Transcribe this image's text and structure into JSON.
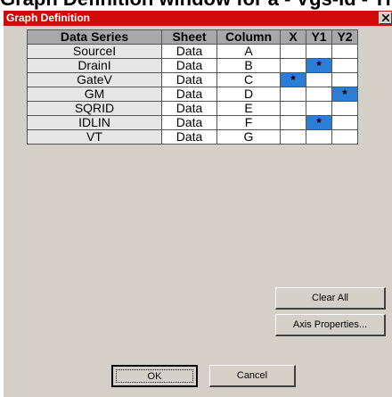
{
  "background_caption": "Graph Definition window for a - Vgs-Id - Th",
  "window": {
    "title": "Graph Definition"
  },
  "table": {
    "headers": [
      "Data Series",
      "Sheet",
      "Column",
      "X",
      "Y1",
      "Y2"
    ],
    "rows": [
      {
        "name": "SourceI",
        "sheet": "Data",
        "column": "A",
        "x": "",
        "y1": "",
        "y2": ""
      },
      {
        "name": "DrainI",
        "sheet": "Data",
        "column": "B",
        "x": "",
        "y1": "*",
        "y2": ""
      },
      {
        "name": "GateV",
        "sheet": "Data",
        "column": "C",
        "x": "*",
        "y1": "",
        "y2": ""
      },
      {
        "name": "GM",
        "sheet": "Data",
        "column": "D",
        "x": "",
        "y1": "",
        "y2": "*"
      },
      {
        "name": "SQRID",
        "sheet": "Data",
        "column": "E",
        "x": "",
        "y1": "",
        "y2": ""
      },
      {
        "name": "IDLIN",
        "sheet": "Data",
        "column": "F",
        "x": "",
        "y1": "*",
        "y2": ""
      },
      {
        "name": "VT",
        "sheet": "Data",
        "column": "G",
        "x": "",
        "y1": "",
        "y2": ""
      }
    ]
  },
  "buttons": {
    "clear_all": "Clear All",
    "axis_properties": "Axis Properties...",
    "ok": "OK",
    "cancel": "Cancel"
  },
  "colors": {
    "titlebar": "#cf0a08",
    "selected_cell": "#2a7fd4",
    "dialog_bg": "#d4d0c8"
  },
  "icons": {
    "close": "close-icon"
  }
}
